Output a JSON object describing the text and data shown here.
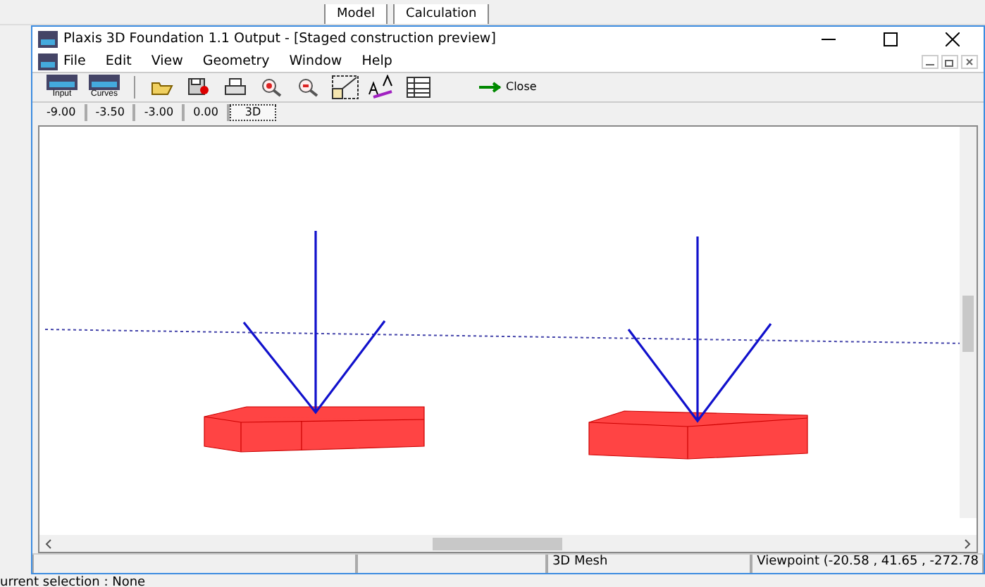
{
  "background_app": {
    "tabs": [
      "Model",
      "Calculation"
    ],
    "status": "urrent selection : None"
  },
  "window": {
    "title": "Plaxis 3D Foundation 1.1 Output - [Staged construction preview]"
  },
  "menu": [
    "File",
    "Edit",
    "View",
    "Geometry",
    "Window",
    "Help"
  ],
  "toolbar": [
    {
      "kind": "labeled",
      "label": "Input"
    },
    {
      "kind": "labeled",
      "label": "Curves"
    },
    {
      "kind": "sep"
    },
    {
      "kind": "icon"
    },
    {
      "kind": "icon"
    },
    {
      "kind": "icon"
    },
    {
      "kind": "icon"
    },
    {
      "kind": "icon"
    },
    {
      "kind": "icon"
    },
    {
      "kind": "icon"
    },
    {
      "kind": "icon"
    },
    {
      "kind": "close",
      "label": "Close"
    }
  ],
  "levels": [
    {
      "label": "-9.00",
      "selected": false
    },
    {
      "label": "-3.50",
      "selected": false
    },
    {
      "label": "-3.00",
      "selected": false
    },
    {
      "label": "0.00",
      "selected": false
    },
    {
      "label": "3D",
      "selected": true
    }
  ],
  "status_bar": [
    "3D Mesh",
    "Viewpoint (-20.58 , 41.65 , -272.78"
  ]
}
